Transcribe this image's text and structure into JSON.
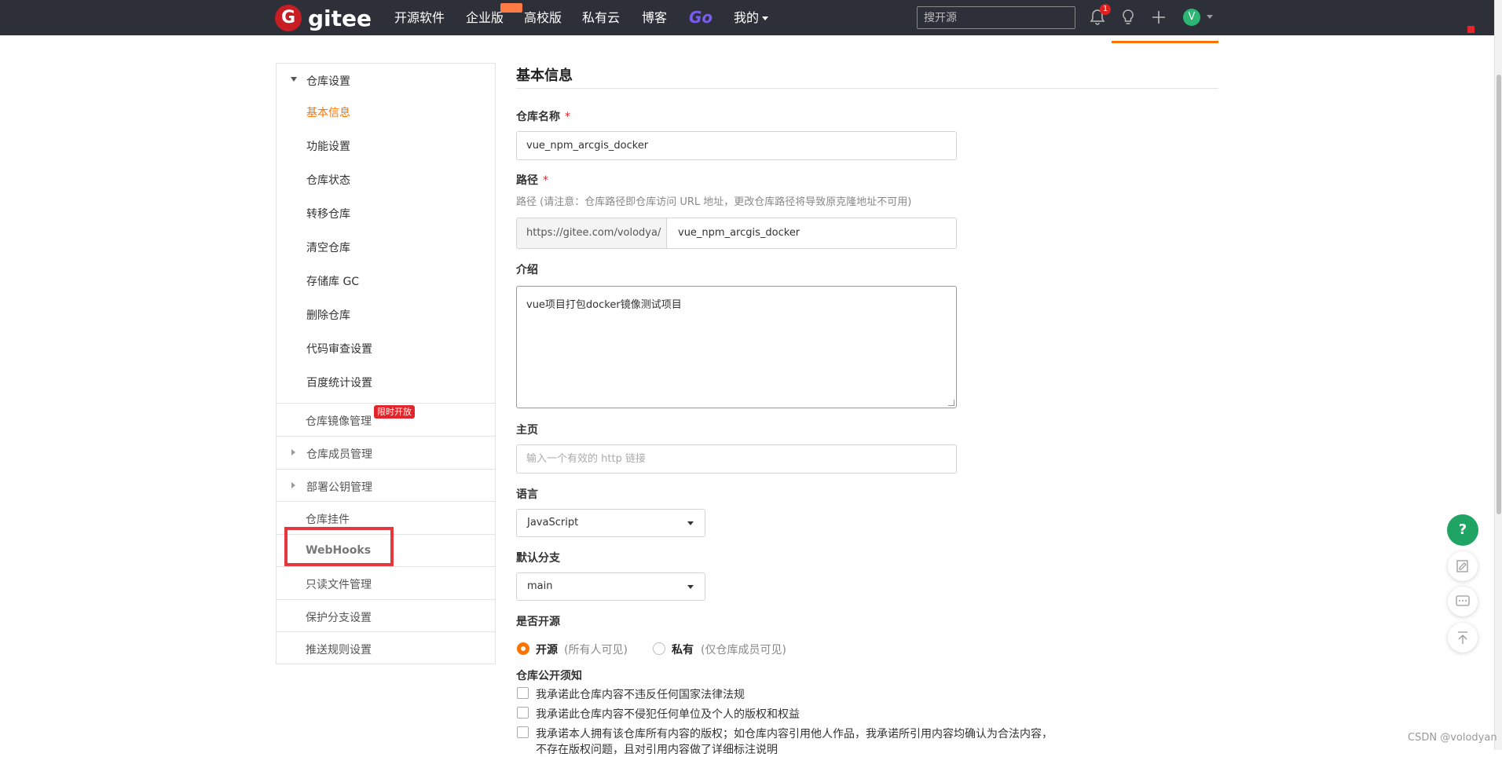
{
  "navbar": {
    "logo_text": "gitee",
    "logo_letter": "G",
    "links": [
      "开源软件",
      "企业版",
      "高校版",
      "私有云",
      "博客"
    ],
    "go_label": "Go",
    "mine_label": "我的",
    "search_placeholder": "搜开源",
    "notification_count": "1",
    "avatar_letter": "V",
    "avatar_color": "#2bb673",
    "accent": "#fe7300"
  },
  "sidebar": {
    "section_title": "仓库设置",
    "sub_items": [
      "基本信息",
      "功能设置",
      "仓库状态",
      "转移仓库",
      "清空仓库",
      "存储库 GC",
      "删除仓库",
      "代码审查设置",
      "百度统计设置"
    ],
    "active_index": 0,
    "rows": [
      {
        "label": "仓库镜像管理",
        "badge": "限时开放"
      },
      {
        "label": "仓库成员管理"
      },
      {
        "label": "部署公钥管理"
      },
      {
        "label": "仓库挂件"
      },
      {
        "label": "WebHooks"
      },
      {
        "label": "只读文件管理"
      },
      {
        "label": "保护分支设置"
      },
      {
        "label": "推送规则设置"
      }
    ]
  },
  "main": {
    "title": "基本信息",
    "repo_name_label": "仓库名称",
    "required_mark": "*",
    "repo_name_value": "vue_npm_arcgis_docker",
    "path_label": "路径",
    "path_hint": "路径 (请注意：仓库路径即仓库访问 URL 地址，更改仓库路径将导致原克隆地址不可用)",
    "path_prefix": "https://gitee.com/volodya/",
    "path_value": "vue_npm_arcgis_docker",
    "intro_label": "介绍",
    "intro_value": "vue项目打包docker镜像测试项目",
    "homepage_label": "主页",
    "homepage_placeholder": "输入一个有效的 http 链接",
    "language_label": "语言",
    "language_value": "JavaScript",
    "branch_label": "默认分支",
    "branch_value": "main",
    "open_label": "是否开源",
    "open_option": "开源",
    "open_note": "(所有人可见)",
    "private_option": "私有",
    "private_note": "(仅仓库成员可见)",
    "notice_label": "仓库公开须知",
    "checks": [
      "我承诺此仓库内容不违反任何国家法律法规",
      "我承诺此仓库内容不侵犯任何单位及个人的版权和权益",
      "我承诺本人拥有该仓库所有内容的版权；如仓库内容引用他人作品，我承诺所引用内容均确认为合法内容，",
      "不存在版权问题，且对引用内容做了详细标注说明"
    ]
  },
  "floating": {
    "help_label": "?"
  },
  "watermark": "CSDN @volodyan"
}
